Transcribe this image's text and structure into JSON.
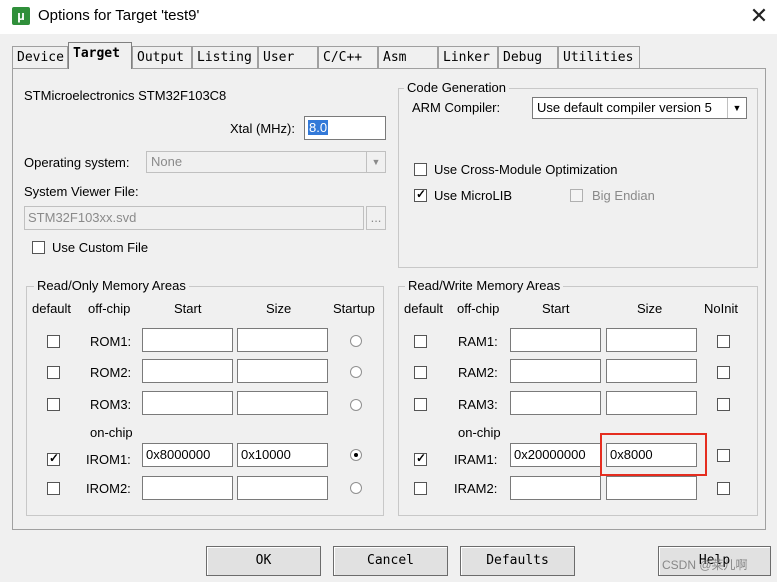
{
  "window": {
    "title": "Options for Target 'test9'",
    "close_glyph": "✕",
    "icon_glyph": "µ"
  },
  "tabs": [
    {
      "label": "Device"
    },
    {
      "label": "Target"
    },
    {
      "label": "Output"
    },
    {
      "label": "Listing"
    },
    {
      "label": "User"
    },
    {
      "label": "C/C++"
    },
    {
      "label": "Asm"
    },
    {
      "label": "Linker"
    },
    {
      "label": "Debug"
    },
    {
      "label": "Utilities"
    }
  ],
  "device": {
    "name": "STMicroelectronics STM32F103C8",
    "xtal_label": "Xtal (MHz):",
    "xtal_value": "8.0",
    "os_label": "Operating system:",
    "os_value": "None",
    "svd_label": "System Viewer File:",
    "svd_value": "STM32F103xx.svd",
    "browse_label": "...",
    "custom_file_label": "Use Custom File"
  },
  "codegen": {
    "title": "Code Generation",
    "compiler_label": "ARM Compiler:",
    "compiler_value": "Use default compiler version 5",
    "cross_module_label": "Use Cross-Module Optimization",
    "microlib_label": "Use MicroLIB",
    "big_endian_label": "Big Endian"
  },
  "ro_memory": {
    "title": "Read/Only Memory Areas",
    "headers": {
      "default": "default",
      "offchip": "off-chip",
      "start": "Start",
      "size": "Size",
      "startup": "Startup"
    },
    "onchip_label": "on-chip",
    "rows": [
      {
        "name": "ROM1:",
        "start": "",
        "size": ""
      },
      {
        "name": "ROM2:",
        "start": "",
        "size": ""
      },
      {
        "name": "ROM3:",
        "start": "",
        "size": ""
      },
      {
        "name": "IROM1:",
        "start": "0x8000000",
        "size": "0x10000"
      },
      {
        "name": "IROM2:",
        "start": "",
        "size": ""
      }
    ]
  },
  "rw_memory": {
    "title": "Read/Write Memory Areas",
    "headers": {
      "default": "default",
      "offchip": "off-chip",
      "start": "Start",
      "size": "Size",
      "noinit": "NoInit"
    },
    "onchip_label": "on-chip",
    "rows": [
      {
        "name": "RAM1:",
        "start": "",
        "size": ""
      },
      {
        "name": "RAM2:",
        "start": "",
        "size": ""
      },
      {
        "name": "RAM3:",
        "start": "",
        "size": ""
      },
      {
        "name": "IRAM1:",
        "start": "0x20000000",
        "size": "0x8000"
      },
      {
        "name": "IRAM2:",
        "start": "",
        "size": ""
      }
    ]
  },
  "buttons": {
    "ok": "OK",
    "cancel": "Cancel",
    "defaults": "Defaults",
    "help": "Help"
  },
  "watermark": "CSDN @莱儿啊",
  "colors": {
    "highlight": "#e52d1f",
    "dialog_bg": "#f0f0f0"
  }
}
